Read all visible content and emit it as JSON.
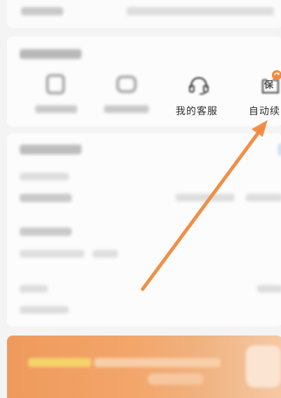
{
  "service_section": {
    "items": [
      {
        "label": "",
        "icon": "shield-check-icon"
      },
      {
        "label": "",
        "icon": "claim-icon"
      },
      {
        "label": "我的客服",
        "icon": "headset-icon"
      },
      {
        "label": "自动续",
        "icon": "auto-renew-icon",
        "icon_text": "保",
        "badge_icon": "refresh-icon"
      }
    ]
  },
  "colors": {
    "accent": "#f08a3e",
    "banner": "#f3a56a",
    "text": "#2c2c2c",
    "icon": "#4a4a4a"
  }
}
